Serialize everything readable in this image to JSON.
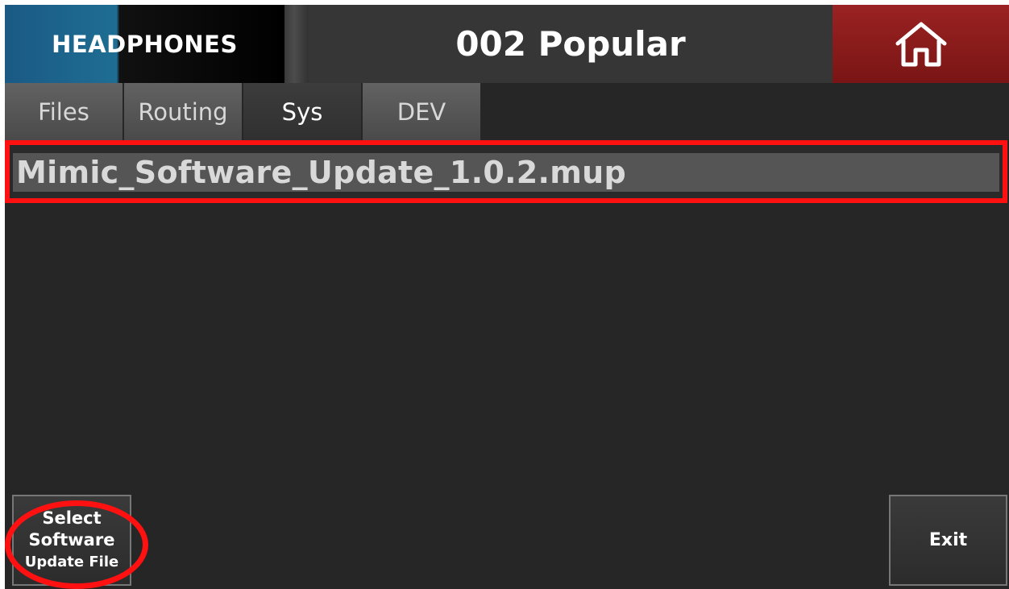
{
  "header": {
    "brand": "HEADPHONES",
    "title": "002 Popular",
    "home_icon": "home-icon"
  },
  "tabs": [
    {
      "label": "Files"
    },
    {
      "label": "Routing"
    },
    {
      "label": "Sys"
    },
    {
      "label": "DEV"
    }
  ],
  "active_tab": "Sys",
  "files": [
    {
      "name": "Mimic_Software_Update_1.0.2.mup"
    }
  ],
  "buttons": {
    "select_line1": "Select",
    "select_line2": "Software",
    "select_line3": "Update File",
    "exit": "Exit"
  },
  "colors": {
    "annotation": "#ff1111",
    "home_button": "#8a1c1c"
  }
}
